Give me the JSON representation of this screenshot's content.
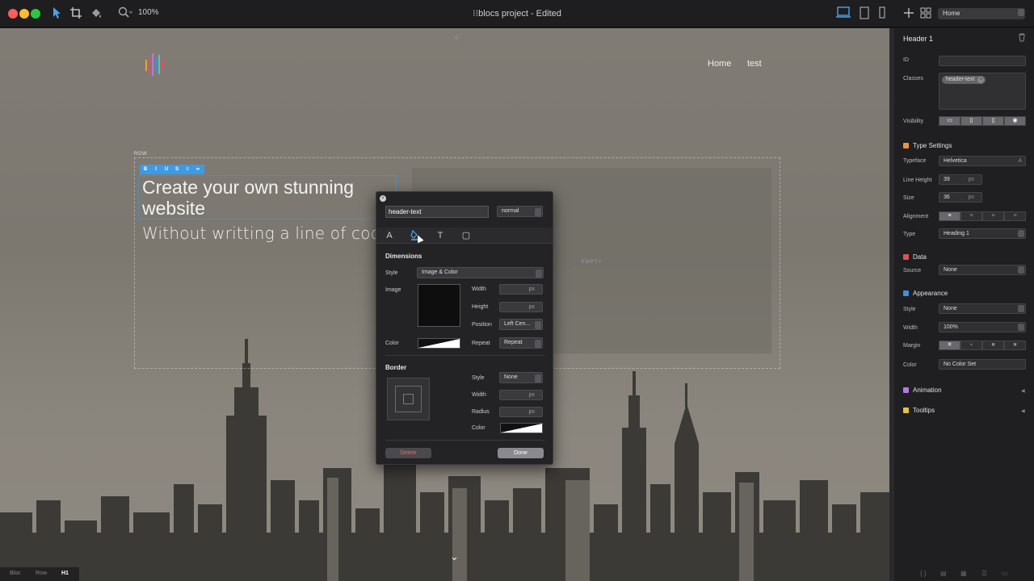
{
  "window": {
    "title": "blocs project - Edited",
    "zoom": "100%",
    "page_select": "Home"
  },
  "canvas": {
    "nav": [
      "Home",
      "test"
    ],
    "row_label": "ROW",
    "heading": "Create your own stunning website",
    "subheading": "Without writting a line of code.",
    "empty_label": "EMPTY",
    "format_buttons": [
      "B",
      "I",
      "U",
      "S",
      "≡",
      "∞"
    ]
  },
  "breadcrumbs": [
    "Bloc",
    "Row",
    "H1"
  ],
  "inspector": {
    "title": "Header 1",
    "id_label": "ID",
    "id_value": "",
    "classes_label": "Classes",
    "class_tag": "header-text",
    "visibility_label": "Visibility",
    "type_settings": "Type Settings",
    "typeface_label": "Typeface",
    "typeface_value": "Helvetica",
    "line_height_label": "Line Height",
    "line_height_value": "39",
    "size_label": "Size",
    "size_value": "36",
    "unit_px": "px",
    "alignment_label": "Alignment",
    "type_label": "Type",
    "type_value": "Heading 1",
    "data_section": "Data",
    "source_label": "Source",
    "source_value": "None",
    "appearance_section": "Appearance",
    "style_label": "Style",
    "style_value": "None",
    "width_label": "Width",
    "width_value": "100%",
    "margin_label": "Margin",
    "color_label": "Color",
    "color_value": "No Color Set",
    "animation_section": "Animation",
    "tooltips_section": "Tooltips",
    "section_colors": {
      "type": "#f0913a",
      "data": "#e05252",
      "appearance": "#3d8fe0",
      "animation": "#b47ae0",
      "tooltips": "#e8c23a"
    }
  },
  "modal": {
    "class_name": "header-text",
    "state": "normal",
    "dimensions_heading": "Dimensions",
    "style_label": "Style",
    "style_value": "Image & Color",
    "image_label": "Image",
    "width_label": "Width",
    "height_label": "Height",
    "position_label": "Position",
    "position_value": "Left Cen...",
    "color_label": "Color",
    "repeat_label": "Repeat",
    "repeat_value": "Repeat",
    "border_heading": "Border",
    "border_style_label": "Style",
    "border_style_value": "None",
    "border_width_label": "Width",
    "radius_label": "Radius",
    "border_color_label": "Color",
    "unit_px": "px",
    "delete_label": "Delete",
    "done_label": "Done"
  }
}
